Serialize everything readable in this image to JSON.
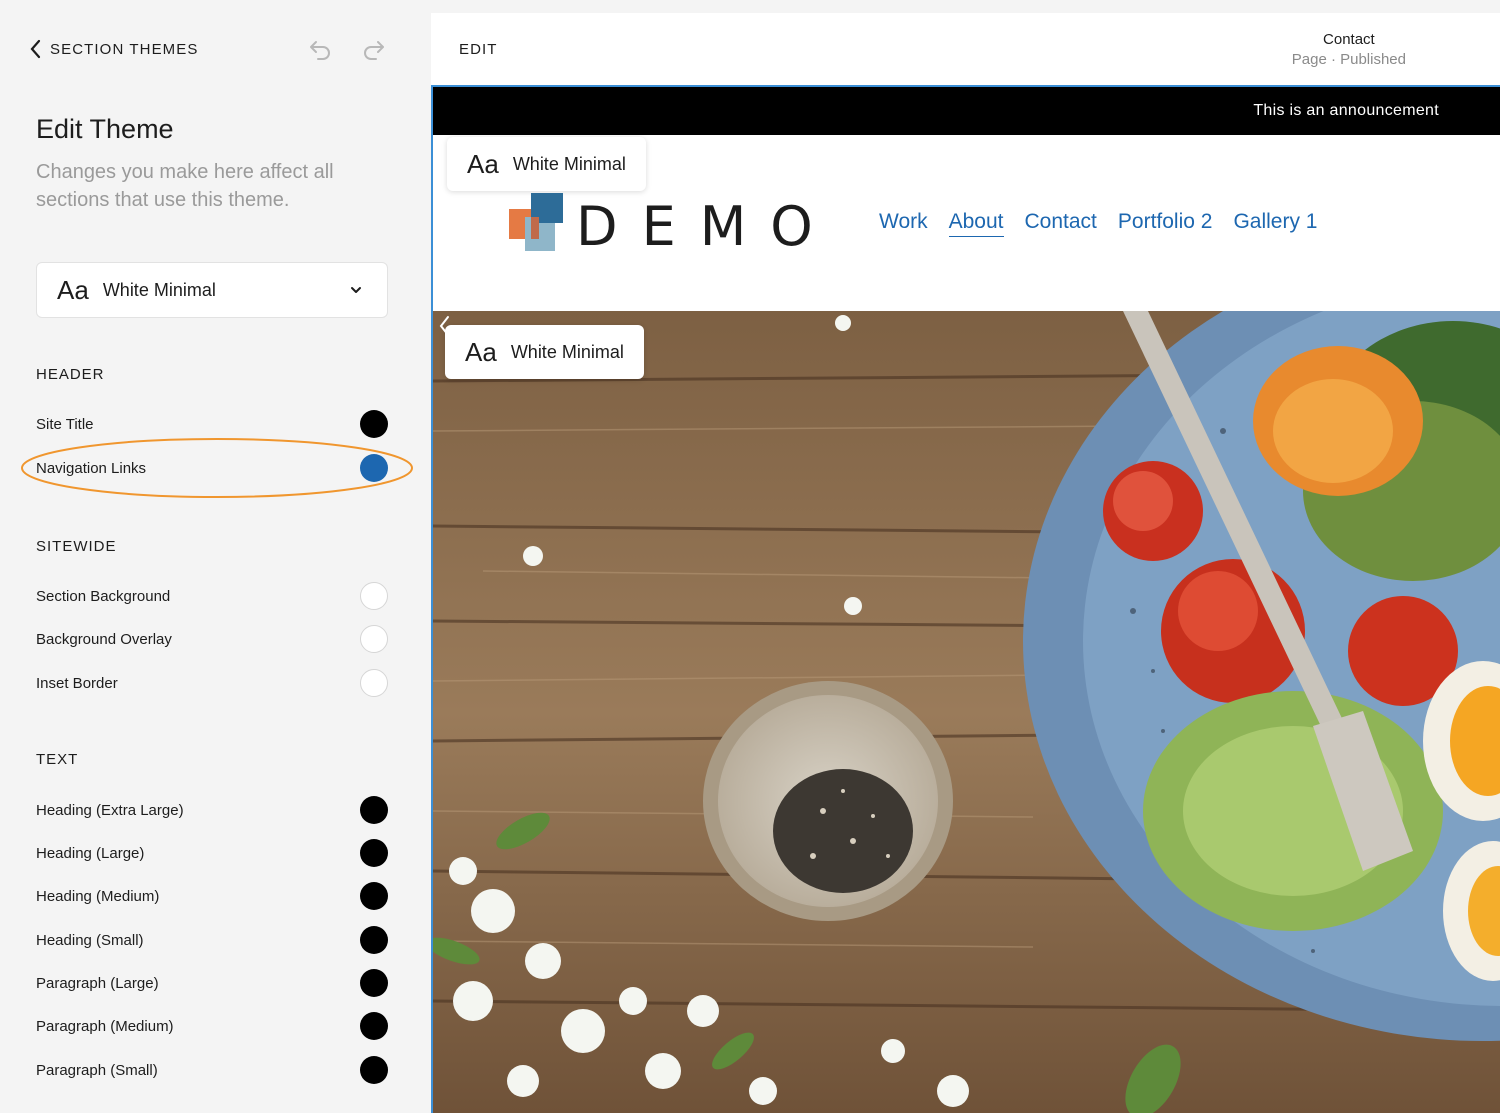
{
  "panel": {
    "back_label": "SECTION THEMES",
    "title": "Edit Theme",
    "subtitle": "Changes you make here affect all sections that use this theme.",
    "theme_select": {
      "aa": "Aa",
      "value": "White Minimal"
    },
    "header": {
      "label": "HEADER",
      "items": [
        {
          "label": "Site Title",
          "color": "#000000"
        },
        {
          "label": "Navigation Links",
          "color": "#1d67b0"
        }
      ]
    },
    "sitewide": {
      "label": "SITEWIDE",
      "items": [
        {
          "label": "Section Background",
          "color": "#ffffff"
        },
        {
          "label": "Background Overlay",
          "color": "#ffffff"
        },
        {
          "label": "Inset Border",
          "color": "#ffffff"
        }
      ]
    },
    "text": {
      "label": "TEXT",
      "items": [
        {
          "label": "Heading (Extra Large)",
          "color": "#000000"
        },
        {
          "label": "Heading (Large)",
          "color": "#000000"
        },
        {
          "label": "Heading (Medium)",
          "color": "#000000"
        },
        {
          "label": "Heading (Small)",
          "color": "#000000"
        },
        {
          "label": "Paragraph (Large)",
          "color": "#000000"
        },
        {
          "label": "Paragraph (Medium)",
          "color": "#000000"
        },
        {
          "label": "Paragraph (Small)",
          "color": "#000000"
        }
      ]
    },
    "highlight_color": "#f0962e"
  },
  "preview": {
    "edit_label": "EDIT",
    "page_name": "Contact",
    "page_status": "Page · Published",
    "announcement": "This is an announcement",
    "header_theme_tag": {
      "aa": "Aa",
      "name": "White Minimal"
    },
    "hero_theme_tag": {
      "aa": "Aa",
      "name": "White Minimal"
    },
    "site_title": "DEMO",
    "nav": [
      "Work",
      "About",
      "Contact",
      "Portfolio 2",
      "Gallery 1"
    ],
    "active_nav": "About",
    "accent": "#1d67b0"
  }
}
